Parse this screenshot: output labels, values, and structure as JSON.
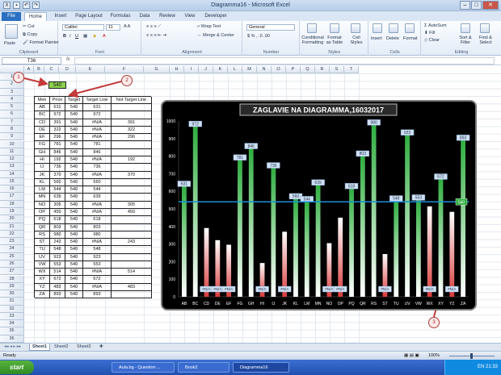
{
  "window": {
    "title": "Diagramma16 - Microsoft Excel"
  },
  "tabs": [
    "File",
    "Home",
    "Insert",
    "Page Layout",
    "Formulas",
    "Data",
    "Review",
    "View",
    "Developer"
  ],
  "ribbon": {
    "clipboard": {
      "paste": "Paste",
      "cut": "Cut",
      "copy": "Copy",
      "format_painter": "Format Painter",
      "label": "Clipboard"
    },
    "font": {
      "name": "Calibri",
      "size": "11",
      "label": "Font"
    },
    "alignment": {
      "wrap": "Wrap Text",
      "merge": "Merge & Center",
      "label": "Alignment"
    },
    "number": {
      "format": "General",
      "label": "Number"
    },
    "styles": {
      "cond": "Conditional Formatting",
      "table": "Format as Table",
      "cell": "Cell Styles",
      "label": "Styles"
    },
    "cells": {
      "insert": "Insert",
      "delete": "Delete",
      "format": "Format",
      "label": "Cells"
    },
    "editing": {
      "autosum": "AutoSum",
      "fill": "Fill",
      "clear": "Clear",
      "sort": "Sort & Filter",
      "find": "Find & Select",
      "label": "Editing"
    }
  },
  "formula_bar": {
    "name_box": "T36",
    "fx": "fx"
  },
  "columns": [
    "A",
    "B",
    "C",
    "D",
    "E",
    "F",
    "G",
    "H",
    "I",
    "J",
    "K",
    "L",
    "M",
    "N",
    "O",
    "P",
    "Q",
    "R",
    "S",
    "T"
  ],
  "target_cell": "540",
  "callouts": [
    "1",
    "2",
    "3"
  ],
  "table": {
    "headers": [
      "Men",
      "Price",
      "Target",
      "Target Line",
      "Not Target Line"
    ],
    "rows": [
      [
        "AB",
        "631",
        "540",
        "631",
        ""
      ],
      [
        "BC",
        "972",
        "540",
        "972",
        ""
      ],
      [
        "CD",
        "391",
        "540",
        "#N/A",
        "391"
      ],
      [
        "DE",
        "322",
        "540",
        "#N/A",
        "322"
      ],
      [
        "EF",
        "296",
        "540",
        "#N/A",
        "296"
      ],
      [
        "FG",
        "781",
        "540",
        "781",
        ""
      ],
      [
        "GH",
        "846",
        "540",
        "846",
        ""
      ],
      [
        "HI",
        "192",
        "540",
        "#N/A",
        "192"
      ],
      [
        "IJ",
        "736",
        "540",
        "736",
        ""
      ],
      [
        "JK",
        "370",
        "540",
        "#N/A",
        "370"
      ],
      [
        "KL",
        "560",
        "540",
        "560",
        ""
      ],
      [
        "LM",
        "544",
        "540",
        "544",
        ""
      ],
      [
        "MN",
        "639",
        "540",
        "639",
        ""
      ],
      [
        "NO",
        "305",
        "540",
        "#N/A",
        "305"
      ],
      [
        "OP",
        "450",
        "540",
        "#N/A",
        "450"
      ],
      [
        "PQ",
        "618",
        "540",
        "618",
        ""
      ],
      [
        "QR",
        "803",
        "540",
        "803",
        ""
      ],
      [
        "RS",
        "980",
        "540",
        "980",
        ""
      ],
      [
        "ST",
        "243",
        "540",
        "#N/A",
        "243"
      ],
      [
        "TU",
        "548",
        "540",
        "548",
        ""
      ],
      [
        "UV",
        "923",
        "540",
        "923",
        ""
      ],
      [
        "VW",
        "553",
        "540",
        "553",
        ""
      ],
      [
        "WX",
        "514",
        "540",
        "#N/A",
        "514"
      ],
      [
        "XY",
        "672",
        "540",
        "672",
        ""
      ],
      [
        "YZ",
        "483",
        "540",
        "#N/A",
        "483"
      ],
      [
        "ZA",
        "893",
        "540",
        "893",
        ""
      ]
    ]
  },
  "chart_data": {
    "type": "bar",
    "title": "ZAGLAVIE NA DIAGRAMMA,16032017",
    "categories": [
      "AB",
      "BC",
      "CD",
      "DE",
      "EF",
      "FG",
      "GH",
      "HI",
      "IJ",
      "JK",
      "KL",
      "LM",
      "MN",
      "NO",
      "OP",
      "PQ",
      "QR",
      "RS",
      "ST",
      "TU",
      "UV",
      "VW",
      "WX",
      "XY",
      "YZ",
      "ZA"
    ],
    "series": [
      {
        "values": [
          631,
          972,
          null,
          null,
          null,
          781,
          846,
          null,
          736,
          null,
          560,
          544,
          639,
          null,
          null,
          618,
          803,
          980,
          null,
          548,
          923,
          553,
          null,
          672,
          null,
          893
        ]
      },
      {
        "values": [
          null,
          null,
          391,
          322,
          296,
          null,
          null,
          192,
          null,
          370,
          null,
          null,
          null,
          305,
          450,
          null,
          null,
          null,
          243,
          null,
          null,
          null,
          514,
          null,
          483,
          null
        ]
      }
    ],
    "target_line": 540,
    "target_label": "540",
    "na_label": "#N/A",
    "yticks": [
      0,
      100,
      200,
      300,
      400,
      500,
      600,
      700,
      800,
      900,
      1000
    ],
    "ylim": [
      0,
      1000
    ],
    "colors": {
      "above": "#2fae3f",
      "below": "#d93a3a",
      "target": "#1a8fd8",
      "background": "#000000"
    }
  },
  "sheets": [
    "Sheet1",
    "Sheet2",
    "Sheet3"
  ],
  "status": {
    "ready": "Ready",
    "zoom": "100%"
  },
  "taskbar": {
    "start": "start",
    "items": [
      "Aula.bg - Question ...",
      "Book2",
      "Diagramma16"
    ],
    "lang": "EN",
    "clock": "21:33"
  }
}
